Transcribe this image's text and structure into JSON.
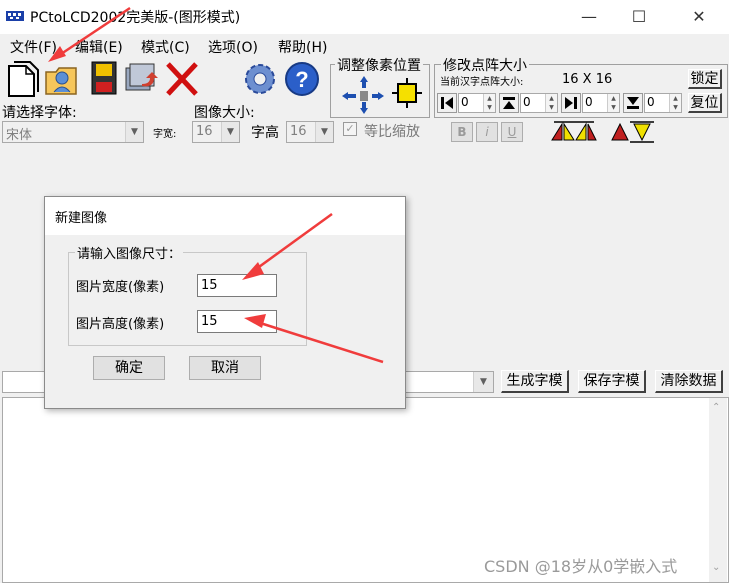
{
  "window": {
    "title": "PCtoLCD2002完美版-(图形模式)",
    "minimize_icon": "minimize-icon",
    "maximize_icon": "maximize-icon",
    "close_icon": "close-icon"
  },
  "menu": {
    "items": [
      {
        "label": "文件(F)"
      },
      {
        "label": "编辑(E)"
      },
      {
        "label": "模式(C)"
      },
      {
        "label": "选项(O)"
      },
      {
        "label": "帮助(H)"
      }
    ]
  },
  "toolbar": {
    "icons": [
      "new-file-icon",
      "open-folder-icon",
      "save-disk-icon",
      "save-as-icon",
      "delete-x-icon",
      "settings-gear-icon",
      "help-question-icon"
    ],
    "adjust_group_title": "调整像素位置",
    "resize_group_title": "修改点阵大小",
    "current_size_label": "当前汉字点阵大小:",
    "current_size_value": "16 X 16",
    "lock_button": "锁定",
    "restore_button": "复位",
    "spin_values": [
      "0",
      "0",
      "0",
      "0"
    ]
  },
  "font_row": {
    "font_label": "请选择字体:",
    "font_value": "宋体",
    "width_label": "字宽:",
    "width_value": "16",
    "image_size_label": "图像大小:",
    "height_label": "字高",
    "height_value": "16",
    "ratio_label": "等比缩放",
    "bold_label": "B",
    "italic_label": "i",
    "underline_label": "U"
  },
  "bottom": {
    "generate_button": "生成字模",
    "save_button": "保存字模",
    "clear_button": "清除数据"
  },
  "dialog": {
    "title": "新建图像",
    "group_title": "请输入图像尺寸：",
    "width_label": "图片宽度(像素)",
    "width_value": "15",
    "height_label": "图片高度(像素)",
    "height_value": "15",
    "ok_button": "确定",
    "cancel_button": "取消"
  },
  "watermark": "CSDN @18岁从0学嵌入式",
  "colors": {
    "annotation_arrow": "#f03c3c",
    "window_bg": "#f0f0f0"
  }
}
